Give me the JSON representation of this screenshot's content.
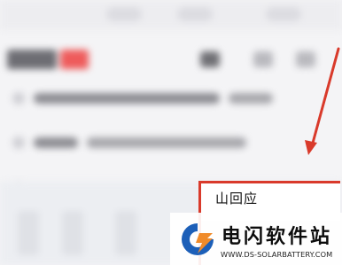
{
  "callout": {
    "label": "山回应"
  },
  "watermark": {
    "site_name": "电闪软件站",
    "url": "WWW.DS-SOLARBATTERY.COM"
  },
  "colors": {
    "highlight_red": "#d93a2b",
    "logo_blue": "#1c5fb8",
    "logo_orange": "#f08b2a"
  },
  "icons": [
    "arrow-icon",
    "site-logo-icon"
  ]
}
